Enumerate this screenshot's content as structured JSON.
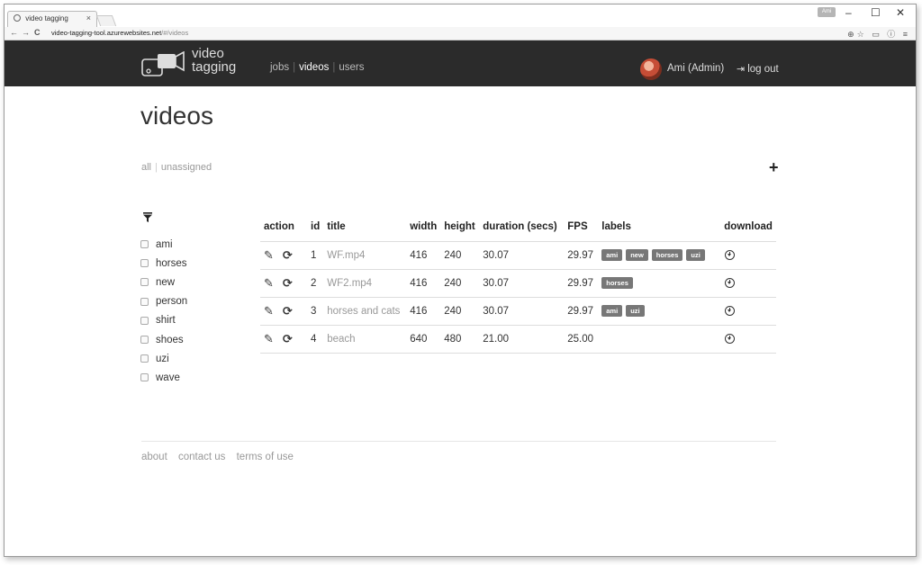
{
  "browser": {
    "tab_title": "video tagging",
    "tab_close": "×",
    "profile_badge": "Ami",
    "window_controls": {
      "minimize": "–",
      "maximize": "☐",
      "close": "✕"
    },
    "url_host": "video-tagging-tool.azurewebsites.net",
    "url_path": "/#/videos",
    "nav": {
      "back": "←",
      "forward": "→",
      "reload": "C"
    },
    "address_icons": "⊕☆ ▭ ⓘ ≡"
  },
  "header": {
    "logo_line1": "video",
    "logo_line2": "tagging",
    "nav": {
      "jobs": "jobs",
      "videos": "videos",
      "users": "users"
    },
    "user": "Ami (Admin)",
    "logout": "log out",
    "logout_icon": "⇥"
  },
  "page": {
    "title": "videos",
    "filters": {
      "all": "all",
      "unassigned": "unassigned"
    },
    "add_icon": "+"
  },
  "labels": [
    "ami",
    "horses",
    "new",
    "person",
    "shirt",
    "shoes",
    "uzi",
    "wave"
  ],
  "table": {
    "headers": {
      "action": "action",
      "id": "id",
      "title": "title",
      "width": "width",
      "height": "height",
      "duration": "duration (secs)",
      "fps": "FPS",
      "labels": "labels",
      "download": "download"
    },
    "edit_icon": "✎",
    "refresh_icon": "⟳",
    "rows": [
      {
        "id": "1",
        "title": "WF.mp4",
        "width": "416",
        "height": "240",
        "duration": "30.07",
        "fps": "29.97",
        "labels": [
          "ami",
          "new",
          "horses",
          "uzi"
        ]
      },
      {
        "id": "2",
        "title": "WF2.mp4",
        "width": "416",
        "height": "240",
        "duration": "30.07",
        "fps": "29.97",
        "labels": [
          "horses"
        ]
      },
      {
        "id": "3",
        "title": "horses and cats",
        "width": "416",
        "height": "240",
        "duration": "30.07",
        "fps": "29.97",
        "labels": [
          "ami",
          "uzi"
        ]
      },
      {
        "id": "4",
        "title": "beach",
        "width": "640",
        "height": "480",
        "duration": "21.00",
        "fps": "25.00",
        "labels": []
      }
    ]
  },
  "footer": {
    "about": "about",
    "contact": "contact us",
    "terms": "terms of use"
  },
  "colors": {
    "appbar": "#2b2b2b",
    "chip": "#777777",
    "muted_text": "#999999"
  }
}
